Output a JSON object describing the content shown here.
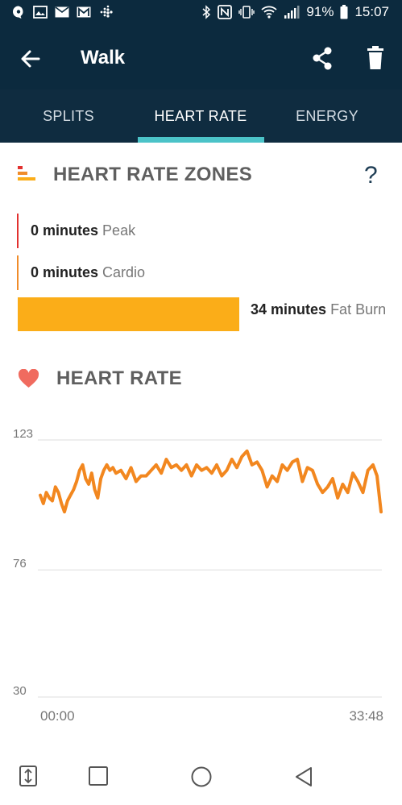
{
  "status_bar": {
    "battery": "91%",
    "time": "15:07",
    "left_icons": [
      "chat-icon",
      "image-icon",
      "mail-icon",
      "gmail-icon",
      "fitbit-icon"
    ],
    "right_icons": [
      "bluetooth-icon",
      "nfc-icon",
      "vibrate-icon",
      "wifi-icon",
      "signal-icon",
      "battery-icon"
    ]
  },
  "app_bar": {
    "title": "Walk",
    "back_icon": "arrow-back-icon",
    "share_icon": "share-icon",
    "delete_icon": "trash-icon",
    "color": "#0c2a3e"
  },
  "tabs": [
    {
      "label": "SPLITS",
      "active": false
    },
    {
      "label": "HEART RATE",
      "active": true
    },
    {
      "label": "ENERGY",
      "active": false
    }
  ],
  "tab_indicator_color": "#4bc3c8",
  "zones": {
    "title": "HEART RATE ZONES",
    "help_label": "?",
    "items": [
      {
        "minutes": "0 minutes",
        "name": "Peak",
        "color": "#e2312f"
      },
      {
        "minutes": "0 minutes",
        "name": "Cardio",
        "color": "#f08c2a"
      },
      {
        "minutes": "34 minutes",
        "name": "Fat Burn",
        "color": "#fbad18"
      }
    ]
  },
  "heart_rate": {
    "title": "HEART RATE",
    "icon": "heart-icon",
    "heart_color": "#f06b5f"
  },
  "chart_data": {
    "type": "line",
    "title": "HEART RATE",
    "yticks": [
      30,
      76,
      123
    ],
    "ylim": [
      30,
      123
    ],
    "xtick_labels": [
      "00:00",
      "33:48"
    ],
    "x_unit": "minutes",
    "xlim": [
      0,
      33.8
    ],
    "grid": true,
    "color": "#f2871f",
    "series": [
      {
        "x": [
          0,
          0.3,
          0.6,
          0.9,
          1.2,
          1.5,
          1.8,
          2.1,
          2.4,
          2.7,
          3.0,
          3.3,
          3.6,
          3.9,
          4.2,
          4.5,
          4.8,
          5.1,
          5.4,
          5.7,
          6.0,
          6.3,
          6.6,
          6.9,
          7.2,
          7.5,
          8.0,
          8.5,
          9.0,
          9.5,
          10.0,
          10.5,
          11.0,
          11.5,
          12.0,
          12.5,
          13.0,
          13.5,
          14.0,
          14.5,
          15.0,
          15.5,
          16.0,
          16.5,
          17.0,
          17.5,
          18.0,
          18.5,
          19.0,
          19.5,
          20.0,
          20.5,
          21.0,
          21.5,
          22.0,
          22.5,
          23.0,
          23.5,
          24.0,
          24.5,
          25.0,
          25.5,
          26.0,
          26.5,
          27.0,
          27.5,
          28.0,
          28.5,
          29.0,
          29.5,
          30.0,
          30.5,
          31.0,
          31.5,
          32.0,
          32.5,
          33.0,
          33.4,
          33.8
        ],
        "y": [
          103,
          100,
          104,
          102,
          101,
          106,
          104,
          100,
          97,
          101,
          103,
          105,
          108,
          112,
          114,
          109,
          107,
          111,
          105,
          102,
          109,
          112,
          114,
          112,
          113,
          111,
          112,
          109,
          113,
          108,
          110,
          110,
          112,
          114,
          111,
          116,
          113,
          114,
          112,
          114,
          110,
          114,
          112,
          113,
          111,
          114,
          110,
          112,
          116,
          113,
          117,
          119,
          114,
          115,
          112,
          106,
          110,
          108,
          114,
          112,
          115,
          116,
          108,
          113,
          112,
          107,
          104,
          106,
          109,
          102,
          107,
          104,
          111,
          108,
          104,
          112,
          114,
          110,
          97
        ]
      }
    ]
  },
  "nav_bar": {
    "icons": [
      "swap-icon",
      "recents-icon",
      "home-icon",
      "back-icon"
    ]
  }
}
